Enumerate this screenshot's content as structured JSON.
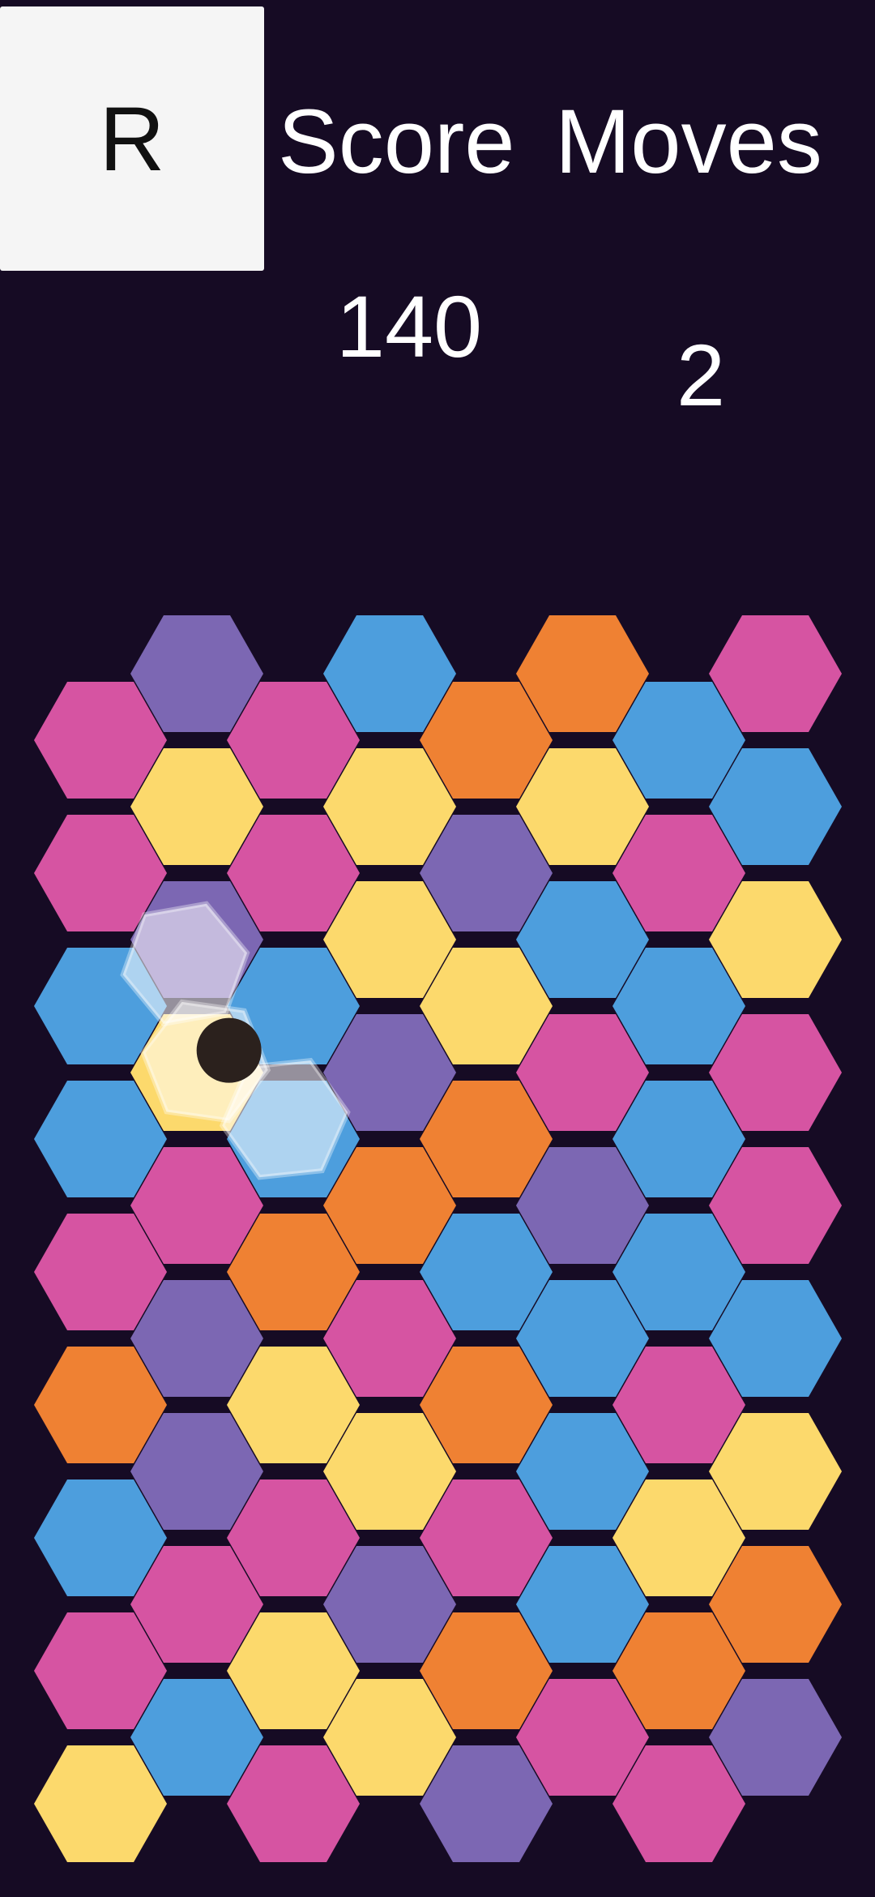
{
  "header": {
    "reset_label": "R",
    "score_label": "Score",
    "moves_label": "Moves",
    "score_value": "140",
    "moves_value": "2"
  },
  "palette": {
    "purple": "#7c67b3",
    "blue": "#4d9edd",
    "orange": "#ef8133",
    "pink": "#d654a2",
    "yellow": "#fcd96c"
  },
  "background_color": "#160b24",
  "board": {
    "columns": [
      [
        "pink",
        "pink",
        "blue",
        "blue",
        "pink",
        "orange",
        "blue",
        "pink",
        "yellow"
      ],
      [
        "purple",
        "yellow",
        "purple",
        "yellow",
        "pink",
        "purple",
        "purple",
        "pink",
        "blue"
      ],
      [
        "pink",
        "pink",
        "blue",
        "blue",
        "orange",
        "yellow",
        "pink",
        "yellow",
        "pink"
      ],
      [
        "blue",
        "yellow",
        "yellow",
        "purple",
        "orange",
        "pink",
        "yellow",
        "purple",
        "yellow"
      ],
      [
        "orange",
        "purple",
        "yellow",
        "orange",
        "blue",
        "orange",
        "pink",
        "orange",
        "purple"
      ],
      [
        "orange",
        "yellow",
        "blue",
        "pink",
        "purple",
        "blue",
        "blue",
        "blue",
        "pink"
      ],
      [
        "blue",
        "pink",
        "blue",
        "blue",
        "blue",
        "pink",
        "yellow",
        "orange",
        "pink"
      ],
      [
        "pink",
        "blue",
        "yellow",
        "pink",
        "pink",
        "blue",
        "yellow",
        "orange",
        "purple"
      ]
    ],
    "selection": {
      "pivot_between": [
        [
          1,
          2
        ],
        [
          1,
          3
        ],
        [
          2,
          3
        ]
      ],
      "cursor_color": "#2b211d"
    }
  }
}
